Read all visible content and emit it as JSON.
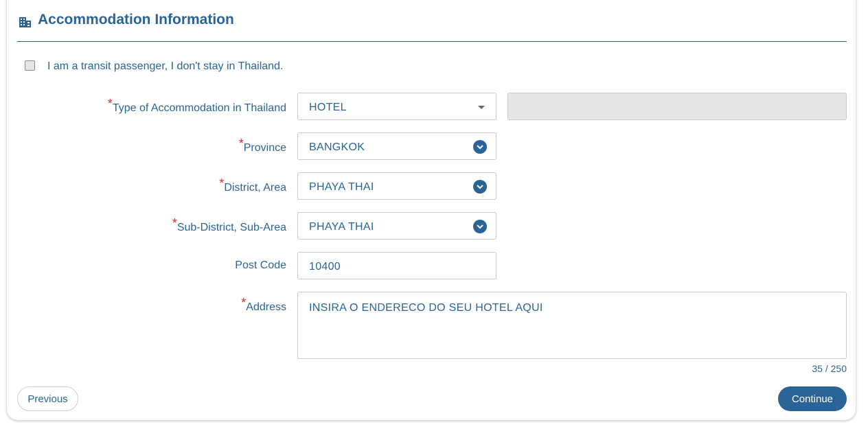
{
  "section": {
    "title": "Accommodation Information",
    "icon": "building-icon"
  },
  "transit": {
    "label": "I am a transit passenger, I don't stay in Thailand.",
    "checked": false
  },
  "fields": {
    "required_marker": "*",
    "accommodation_type": {
      "label": "Type of Accommodation in Thailand",
      "value": "HOTEL"
    },
    "province": {
      "label": "Province",
      "value": "BANGKOK"
    },
    "district": {
      "label": "District, Area",
      "value": "PHAYA THAI"
    },
    "subdistrict": {
      "label": "Sub-District, Sub-Area",
      "value": "PHAYA THAI"
    },
    "postcode": {
      "label": "Post Code",
      "value": "10400"
    },
    "address": {
      "label": "Address",
      "value": "INSIRA O ENDERECO DO SEU HOTEL AQUI",
      "char_count": "35 / 250"
    }
  },
  "buttons": {
    "previous": "Previous",
    "continue": "Continue"
  },
  "colors": {
    "primary": "#2a6496",
    "required": "#d92c2c",
    "disabled_bg": "#e6e6e6"
  }
}
